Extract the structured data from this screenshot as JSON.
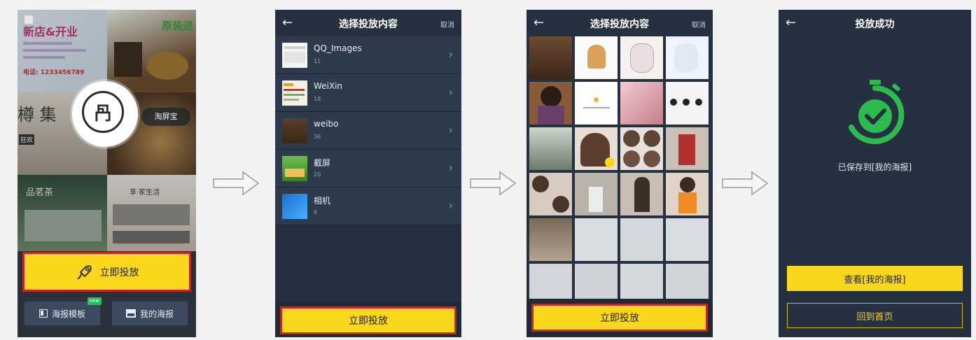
{
  "colors": {
    "accent_yellow": "#f8d71c",
    "dark_panel": "#253140",
    "highlight_red": "#c0262a",
    "success_green": "#2dbb4e"
  },
  "screen1": {
    "brand_label": "淘屏宝",
    "primary_button": "立即投放",
    "btn_templates": "海报模板",
    "btn_templates_badge": "new",
    "btn_my_posters": "我的海报",
    "poster_texts": {
      "t1": "新店&开业",
      "t2": "原装进",
      "t3": "电话: 1233456789",
      "t4": "狂欢",
      "t5": "品茗茶",
      "t6": "享·家生活"
    }
  },
  "screen2": {
    "back_icon": "←",
    "title": "选择投放内容",
    "cancel": "取消",
    "albums": [
      {
        "name": "QQ_Images",
        "count": "11"
      },
      {
        "name": "WeiXin",
        "count": "18"
      },
      {
        "name": "weibo",
        "count": "36"
      },
      {
        "name": "截屏",
        "count": "20"
      },
      {
        "name": "相机",
        "count": "6"
      }
    ],
    "bottom_button": "立即投放"
  },
  "screen3": {
    "back_icon": "←",
    "title": "选择投放内容",
    "cancel": "取消",
    "bottom_button": "立即投放"
  },
  "screen4": {
    "back_icon": "←",
    "title": "投放成功",
    "saved_message": "已保存到[我的海报]",
    "view_button": "查看[我的海报]",
    "home_button": "回到首页"
  }
}
